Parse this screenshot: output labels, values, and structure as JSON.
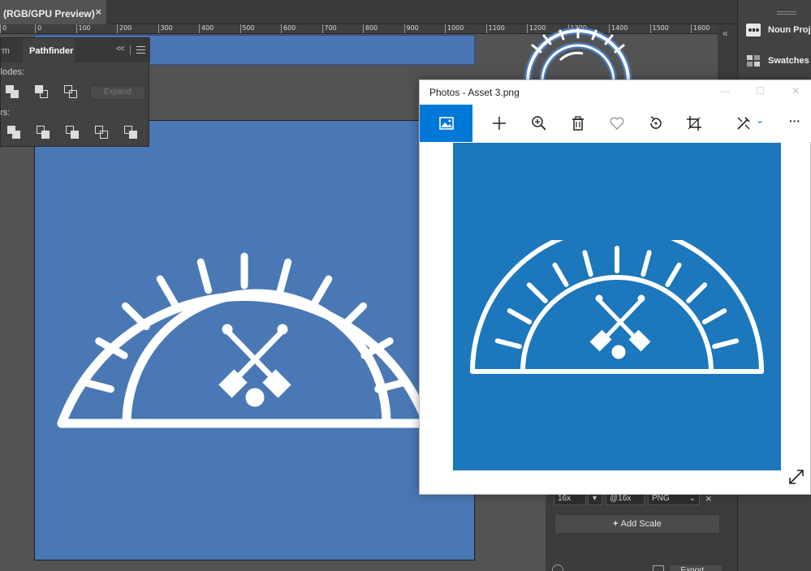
{
  "illustrator": {
    "document_tab_title": "(RGB/GPU Preview)",
    "document_tab_close": "×",
    "ruler_ticks": [
      "0",
      "0",
      "100",
      "200",
      "300",
      "400",
      "500",
      "600",
      "700",
      "800",
      "900",
      "1000",
      "1100",
      "1200",
      "1300",
      "1400",
      "1500",
      "1600"
    ]
  },
  "pathfinder_panel": {
    "tab_inactive_label": "orm",
    "tab_active_label": "Pathfinder",
    "collapse_glyph": "<<",
    "shape_modes_label": "Modes:",
    "pathfinders_label": "ers:",
    "expand_label": "Expand"
  },
  "right_panel": {
    "items": [
      {
        "label": "Noun Project",
        "icon": "noun-project-icon"
      },
      {
        "label": "Swatches",
        "icon": "swatches-icon"
      }
    ],
    "collapse_glyph": "«"
  },
  "export_panel": {
    "scale_value": "16x",
    "suffix_value": "@16x",
    "format_value": "PNG",
    "remove_glyph": "×",
    "add_scale_label": "Add Scale",
    "bottom_button_label": "Export..."
  },
  "photos_window": {
    "title": "Photos - Asset 3.png",
    "controls": [
      "—",
      "☐",
      "✕"
    ],
    "toolbar": [
      "image-icon",
      "add-icon",
      "zoom-icon",
      "delete-icon",
      "favorite-icon",
      "rotate-icon",
      "crop-icon",
      "edit-icon",
      "more-icon"
    ],
    "more_glyph": "···",
    "image_background": "#1c77bc"
  },
  "colors": {
    "artboard": "#4a78b5",
    "photos_accent": "#0078d7",
    "app_background": "#535353"
  }
}
